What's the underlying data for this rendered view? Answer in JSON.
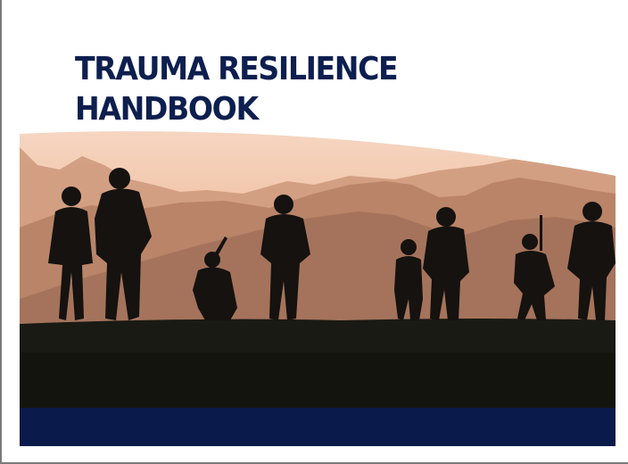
{
  "document": {
    "title_line1": "TRAUMA RESILIENCE",
    "title_line2": "HANDBOOK"
  },
  "colors": {
    "title": "#0d1f4f",
    "band": "#0a1a4a",
    "sky_top": "#f6d6c2",
    "sky_bottom": "#e6ab86"
  },
  "image": {
    "subject": "soldiers-silhouette-at-sunset"
  }
}
